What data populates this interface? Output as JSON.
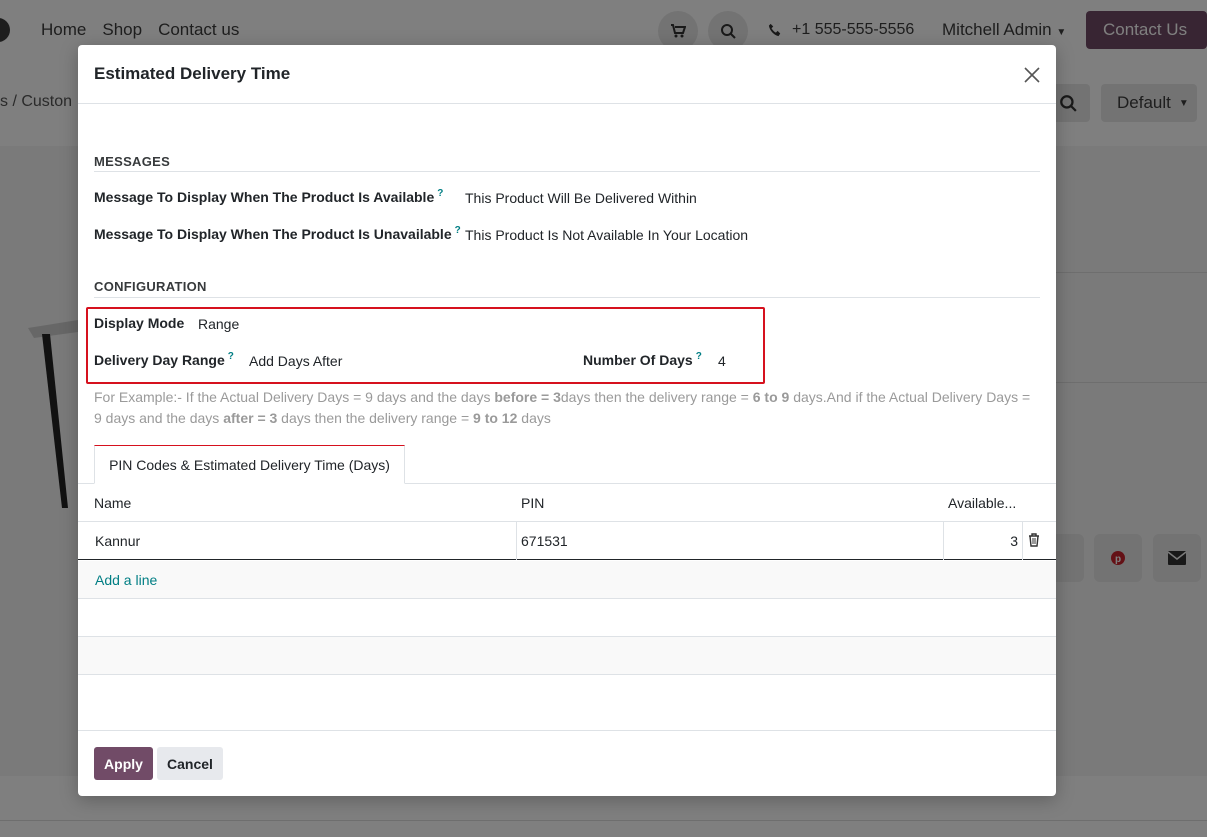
{
  "background": {
    "nav_links": [
      "Home",
      "Shop",
      "Contact us"
    ],
    "phone": "+1 555-555-5556",
    "user": "Mitchell Admin",
    "contact_button": "Contact Us",
    "breadcrumb": "s  /  Custon",
    "sort_default": "Default"
  },
  "modal": {
    "title": "Estimated Delivery Time",
    "messages_section": "MESSAGES",
    "available_label": "Message To Display When The Product Is Available",
    "available_value": "This Product Will Be Delivered Within",
    "unavailable_label": "Message To Display When The Product Is Unavailable",
    "unavailable_value": "This Product Is Not Available In Your Location",
    "config_section": "CONFIGURATION",
    "display_mode_label": "Display Mode",
    "display_mode_value": "Range",
    "day_range_label": "Delivery Day Range",
    "day_range_value": "Add Days After",
    "num_days_label": "Number Of Days",
    "num_days_value": "4",
    "help_mark": "?",
    "example": {
      "t1": "For Example:- If the Actual Delivery Days = 9 days and the days ",
      "b1": "before = 3",
      "t2": "days then the delivery range = ",
      "b2": "6 to 9",
      "t3": " days.And if the Actual Delivery Days = 9 days and the days ",
      "b3": "after = 3",
      "t4": " days then the delivery range = ",
      "b4": "9 to 12",
      "t5": " days"
    },
    "tab_label": "PIN Codes & Estimated Delivery Time (Days)",
    "table": {
      "headers": [
        "Name",
        "PIN",
        "Available..."
      ],
      "rows": [
        {
          "name": "Kannur",
          "pin": "671531",
          "available": "3"
        }
      ],
      "add_line": "Add a line"
    },
    "apply_label": "Apply",
    "cancel_label": "Cancel"
  },
  "colors": {
    "brand": "#714b67",
    "highlight": "#d6111e",
    "link": "#017e84"
  }
}
